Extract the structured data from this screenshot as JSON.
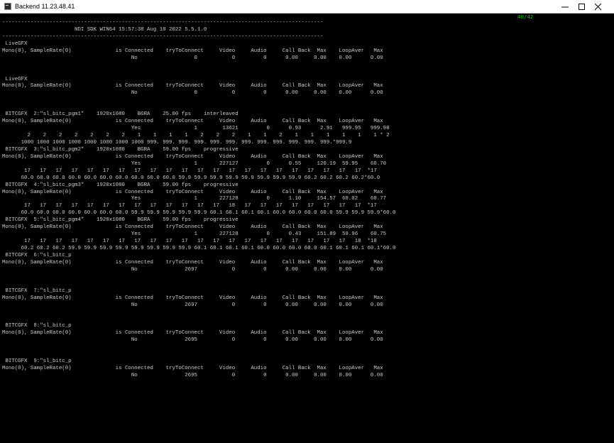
{
  "window": {
    "title": "Backend 11.23.48.41",
    "buttons": {
      "minimize": "minimize-icon",
      "maximize": "maximize-icon",
      "close": "close-icon"
    }
  },
  "console": {
    "counter": "40/42",
    "counter_color": "#16c60c",
    "text_color": "#cccccc",
    "background": "#000000",
    "lines": [
      "------------------------------------------------------------------------------------------------------",
      "                       NDI SDK WIN64 15:57:38 Aug 10 2022 5.5.1.0",
      "------------------------------------------------------------------------------------------------------",
      " LiveGFX",
      "Mono(0), SampleRate(0)              is Connected    tryToConnect     Video     Audio     Call Back  Max    LoopAver   Max",
      "                                         No                  0           0         0      0.00     0.00    0.00      0.00",
      "",
      "",
      " LiveGFX",
      "Mono(0), SampleRate(0)              is Connected    tryToConnect     Video     Audio     Call Back  Max    LoopAver   Max",
      "                                         No                  0           0         0      0.00     0.00    0.00      0.00",
      "",
      "",
      " BITCGFX  2:\"sl_bitc_pgm1\"    1920x1080    BGRA    25.00 fps    interleaved",
      "Mono(0), SampleRate(0)              is Connected    tryToConnect     Video     Audio     Call Back  Max    LoopAver   Max",
      "                                         Yes                 1        13621         0      0.93      2.91   999.95   999.98",
      "        2    2    2    2    2    2    2    1    1    1    1    2    2    2    1    1    2    1    1    1    1    1    1 * 2",
      "      1000 1000 1000 1000 1000 1000 1000 1000 999. 999. 999. 999. 999. 999. 999. 999. 999. 999. 999. 999.*999.9",
      " BITCGFX  3:\"sl_bitc_pgm2\"    1920x1080    BGRA    59.00 fps    progressive",
      "Mono(0), SampleRate(0)              is Connected    tryToConnect     Video     Audio     Call Back  Max    LoopAver   Max",
      "                                         Yes                 1       227127         0      0.55     120.19  59.95    60.70",
      "       17   17   17   17   17   17   17   17   17   17   17   17   17   17   17   17   17   17   17   17   17   17  *17",
      "      60.0 60.0 60.0 60.0 60.0 60.0 60.0 60.0 60.0 60.0 59.9 59.9 59.9 59.9 59.9 59.9 59.9 59.9 60.2 60.2 60.2 60.2*60.0",
      " BITCGFX  4:\"sl_bitc_pgm3\"    1920x1080    BGRA    59.00 fps    progressive",
      "Mono(0), SampleRate(0)              is Connected    tryToConnect     Video     Audio     Call Back  Max    LoopAver   Max",
      "                                         Yes                 1       227128         0      1.10     154.57  60.02    60.77",
      "       17   17   17   17   17   17   17   17   17   17   17   17   17   18   17   17   17   17   17   17   17   17  *17",
      "      60.0 60.0 60.0 60.0 60.0 60.0 60.0 59.9 59.9 59.9 59.9 59.9 60.1 60.1 60.1 60.1 60.0 60.0 60.0 60.0 59.9 59.9 59.9*60.0",
      " BITCGFX  5:\"sl_bitc_pgm4\"    1920x1080    BGRA    59.00 fps    progressive",
      "Mono(0), SampleRate(0)              is Connected    tryToConnect     Video     Audio     Call Back  Max    LoopAver   Max",
      "                                         Yes                 1       227128         0      0.43     151.89  59.96    60.75",
      "       17   17   17   17   17   17   17   17   17   17   17   17   17   17   17   17   17   17   17   17   17   18  *18",
      "      60.2 60.2 60.2 59.9 59.9 59.9 59.9 59.9 59.9 59.9 59.9 60.1 60.1 60.1 60.1 60.0 60.0 60.0 60.0 60.1 60.1 60.1 60.1*60.0",
      " BITCGFX  6:\"sl_bitc_p",
      "Mono(0), SampleRate(0)              is Connected    tryToConnect     Video     Audio     Call Back  Max    LoopAver   Max",
      "                                         No               2697           0         0      0.00     0.00    0.00      0.00",
      "",
      "",
      " BITCGFX  7:\"sl_bitc_p",
      "Mono(0), SampleRate(0)              is Connected    tryToConnect     Video     Audio     Call Back  Max    LoopAver   Max",
      "                                         No               2697           0         0      0.00     0.00    0.00      0.00",
      "",
      "",
      " BITCGFX  8:\"sl_bitc_p",
      "Mono(0), SampleRate(0)              is Connected    tryToConnect     Video     Audio     Call Back  Max    LoopAver   Max",
      "                                         No               2695           0         0      0.00     0.00    0.00      0.00",
      "",
      "",
      " BITCGFX  9:\"sl_bitc_p",
      "Mono(0), SampleRate(0)              is Connected    tryToConnect     Video     Audio     Call Back  Max    LoopAver   Max",
      "                                         No               2695           0         0      0.00     0.00    0.00      0.00"
    ]
  }
}
